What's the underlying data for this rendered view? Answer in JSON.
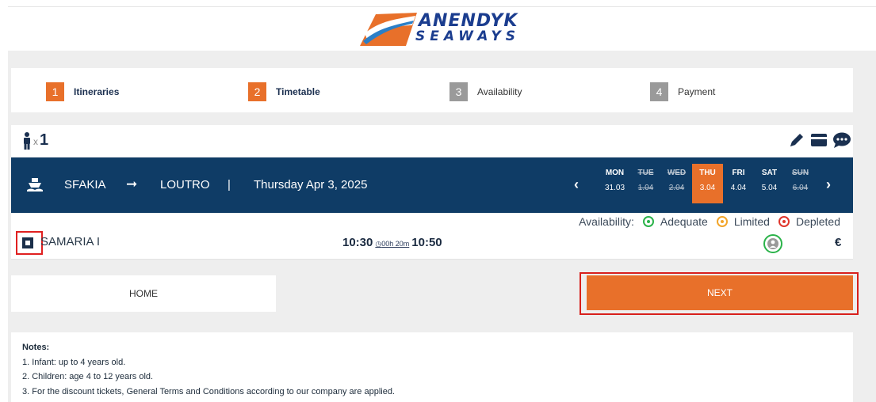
{
  "brand": {
    "name_line1": "ANENDYK",
    "name_line2": "SEAWAYS"
  },
  "steps": [
    {
      "number": "1",
      "label": "Itineraries",
      "active": true
    },
    {
      "number": "2",
      "label": "Timetable",
      "active": true
    },
    {
      "number": "3",
      "label": "Availability",
      "active": false
    },
    {
      "number": "4",
      "label": "Payment",
      "active": false
    }
  ],
  "passengers": {
    "multiplier": "x",
    "count": "1"
  },
  "route": {
    "from": "SFAKIA",
    "arrow": "➞",
    "to": "LOUTRO",
    "separator": "|",
    "date": "Thursday Apr 3, 2025"
  },
  "calendar": {
    "days": [
      {
        "name": "MON",
        "date": "31.03",
        "struck": false,
        "selected": false
      },
      {
        "name": "TUE",
        "date": "1.04",
        "struck": true,
        "selected": false
      },
      {
        "name": "WED",
        "date": "2.04",
        "struck": true,
        "selected": false
      },
      {
        "name": "THU",
        "date": "3.04",
        "struck": false,
        "selected": true
      },
      {
        "name": "FRI",
        "date": "4.04",
        "struck": false,
        "selected": false
      },
      {
        "name": "SAT",
        "date": "5.04",
        "struck": false,
        "selected": false
      },
      {
        "name": "SUN",
        "date": "6.04",
        "struck": true,
        "selected": false
      }
    ]
  },
  "availability_legend": {
    "label": "Availability:",
    "items": [
      {
        "label": "Adequate",
        "color": "#2bb34a"
      },
      {
        "label": "Limited",
        "color": "#f2a52a"
      },
      {
        "label": "Depleted",
        "color": "#e0352b"
      }
    ]
  },
  "trip": {
    "vessel": "SAMARIA I",
    "departure": "10:30",
    "duration": "00h 20m",
    "arrival": "10:50",
    "currency": "€"
  },
  "buttons": {
    "home": "HOME",
    "next": "NEXT"
  },
  "notes": {
    "title": "Notes:",
    "lines": [
      "1. Infant: up to 4 years old.",
      "2. Children: age 4 to 12 years old.",
      "3. For the discount tickets, General Terms and Conditions according to our company are applied."
    ]
  },
  "colors": {
    "accent": "#e8702a",
    "navy": "#0f3c66",
    "available": "#2bb34a"
  }
}
